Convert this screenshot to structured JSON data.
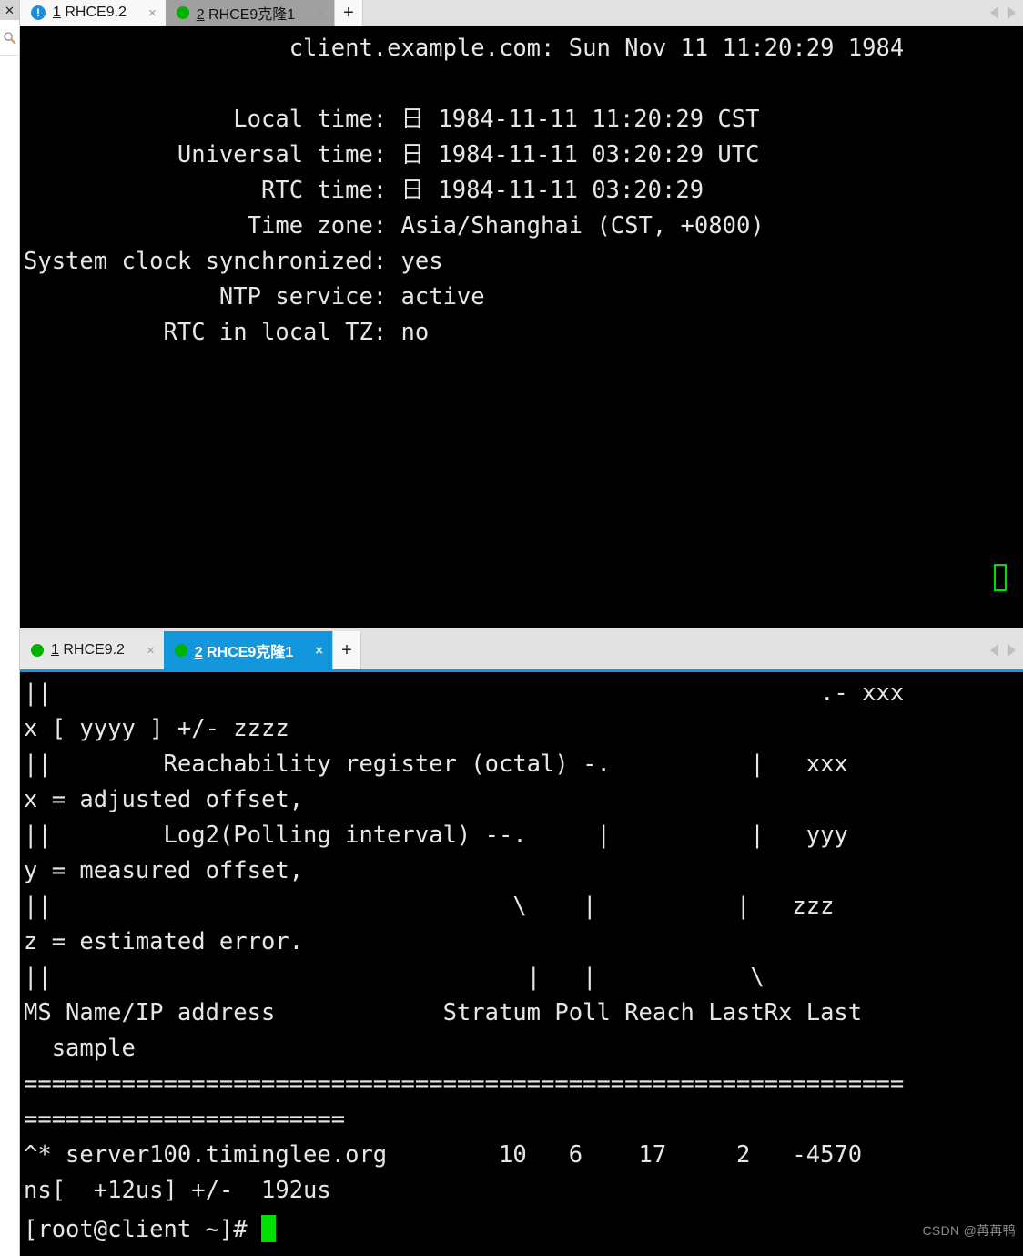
{
  "left_rail": {
    "close_glyph": "✕",
    "search_icon": "search-icon"
  },
  "window_top": {
    "tabbar": {
      "tabs": [
        {
          "icon": "info-exclamation-icon",
          "number": "1",
          "title": " RHCE9.2",
          "state": "selected-white",
          "close": "×"
        },
        {
          "icon": "green-dot-icon",
          "number": "2",
          "title": " RHCE9克隆1",
          "state": "selected-gray",
          "close": "×"
        }
      ],
      "add_label": "+",
      "nav_left": "scroll-left-arrow",
      "nav_right": "scroll-right-arrow"
    },
    "terminal": {
      "lines": [
        "                   client.example.com: Sun Nov 11 11:20:29 1984",
        "",
        "               Local time: 日 1984-11-11 11:20:29 CST",
        "           Universal time: 日 1984-11-11 03:20:29 UTC",
        "                 RTC time: 日 1984-11-11 03:20:29",
        "                Time zone: Asia/Shanghai (CST, +0800)",
        "System clock synchronized: yes",
        "              NTP service: active",
        "          RTC in local TZ: no"
      ],
      "cursor_style": "hollow-green-block"
    }
  },
  "window_bottom": {
    "tabbar": {
      "tabs": [
        {
          "icon": "green-dot-icon",
          "number": "1",
          "title": " RHCE9.2",
          "state": "plain",
          "close": "×"
        },
        {
          "icon": "green-dot-icon",
          "number": "2",
          "title": " RHCE9克隆1",
          "state": "selected-blue",
          "close": "×"
        }
      ],
      "add_label": "+",
      "nav_left": "scroll-left-arrow",
      "nav_right": "scroll-right-arrow"
    },
    "terminal": {
      "lines": [
        "||                                                       .- xxx",
        "x [ yyyy ] +/- zzzz",
        "||        Reachability register (octal) -.          |   xxx",
        "x = adjusted offset,",
        "||        Log2(Polling interval) --.     |          |   yyy",
        "y = measured offset,",
        "||                                 \\    |          |   zzz",
        "z = estimated error.",
        "||                                  |   |           \\",
        "MS Name/IP address            Stratum Poll Reach LastRx Last",
        "  sample",
        "===============================================================",
        "=======================",
        "^* server100.timinglee.org        10   6    17     2   -4570",
        "ns[  +12us] +/-  192us"
      ],
      "prompt": "[root@client ~]# ",
      "cursor_style": "solid-green-block"
    }
  },
  "watermark": "CSDN @苒苒鸭",
  "colors": {
    "terminal_bg": "#000000",
    "terminal_fg": "#e6e6e6",
    "active_tab_blue": "#1496dd",
    "tabbar_bg": "#e2e2e2",
    "cursor_green": "#00e000",
    "status_dot_green": "#00b300",
    "info_icon_blue": "#1e8fe0"
  }
}
